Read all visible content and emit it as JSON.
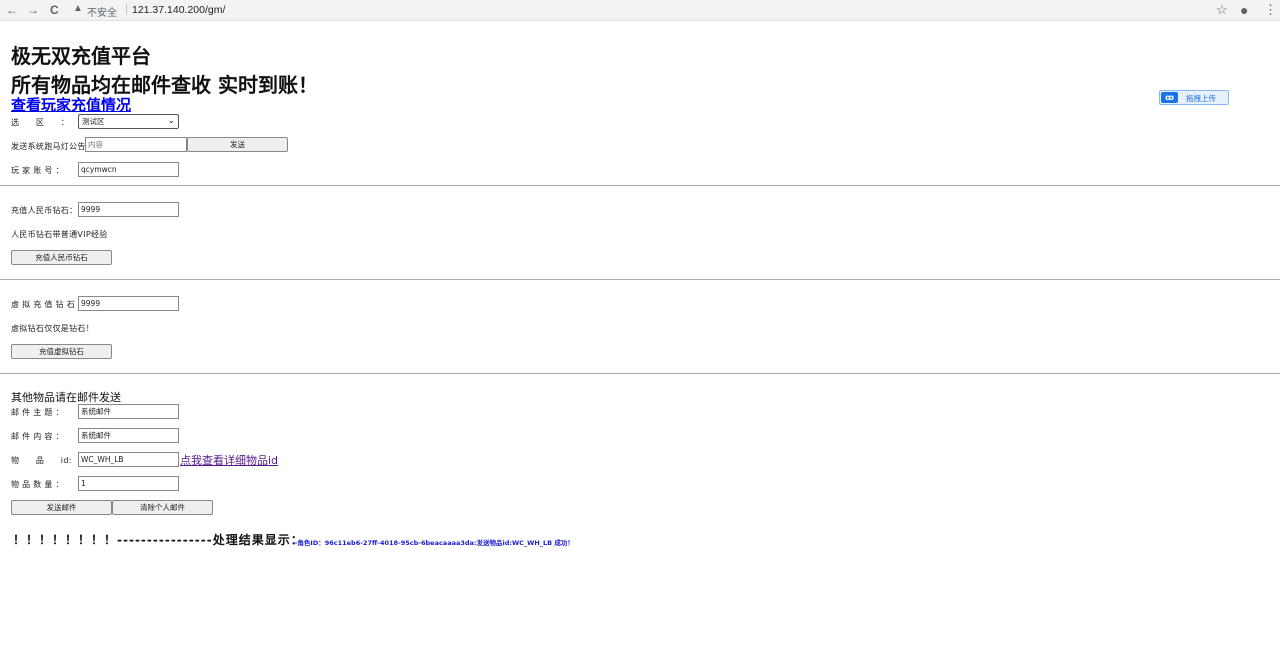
{
  "browser": {
    "back_icon": "←",
    "forward_icon": "→",
    "reload_icon": "C",
    "security_label": "不安全",
    "url": "121.37.140.200/gm/",
    "star_icon": "☆",
    "account_icon": "●",
    "menu_icon": "⋮"
  },
  "header": {
    "title_line1": "极无双充值平台",
    "title_line2": "所有物品均在邮件查收 实时到账！",
    "player_recharge_link": "查看玩家充值情况"
  },
  "upload_widget": {
    "label": "拖拽上传"
  },
  "server_select": {
    "label": "选　　区　　：",
    "selected": "测试区"
  },
  "announcement": {
    "label": "发送系统跑马灯公告：",
    "placeholder": "内容",
    "send_button": "发送"
  },
  "player_account": {
    "label": "玩 家 账 号 ：",
    "value": "qcymwcn"
  },
  "rmb_diamond": {
    "label": "充值人民币钻石：",
    "value": "9999",
    "note": "人民币钻石带普通VIP经验",
    "button": "充值人民币钻石"
  },
  "virtual_diamond": {
    "label": "虚 拟 充 值 钻 石 ：",
    "value": "9999",
    "note": "虚拟钻石仅仅是钻石！",
    "button": "充值虚拟钻石"
  },
  "mail": {
    "section_title": "其他物品请在邮件发送",
    "subject_label": "邮 件 主 题 ：",
    "subject_value": "系统邮件",
    "content_label": "邮 件 内 容 ：",
    "content_value": "系统邮件",
    "item_label": "物　　品　　id:",
    "item_value": "WC_WH_LB",
    "item_link": "点我查看详细物品id",
    "quantity_label": "物 品 数 量 ：",
    "quantity_value": "1",
    "send_button": "发送邮件",
    "clear_button": "清除个人邮件"
  },
  "result": {
    "prefix": "！！！！！！！！----------------处理结果显示：",
    "text": "--角色ID：96c11eb6-27ff-4018-95cb-6beacaaaa3da:发送物品id:WC_WH_LB 成功！"
  }
}
